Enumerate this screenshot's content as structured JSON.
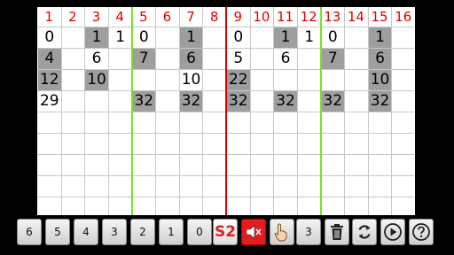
{
  "board": {
    "column_numbers": [
      "1",
      "2",
      "3",
      "4",
      "5",
      "6",
      "7",
      "8",
      "9",
      "10",
      "11",
      "12",
      "13",
      "14",
      "15",
      "16"
    ],
    "separator_colors": {
      "green": "#7be02a",
      "red": "#e00000"
    },
    "cells": [
      {
        "row": 0,
        "col": 0,
        "value": "0",
        "shaded": false
      },
      {
        "row": 0,
        "col": 2,
        "value": "1",
        "shaded": true
      },
      {
        "row": 0,
        "col": 3,
        "value": "1",
        "shaded": false
      },
      {
        "row": 0,
        "col": 4,
        "value": "0",
        "shaded": false
      },
      {
        "row": 0,
        "col": 6,
        "value": "1",
        "shaded": true
      },
      {
        "row": 0,
        "col": 8,
        "value": "0",
        "shaded": false
      },
      {
        "row": 0,
        "col": 10,
        "value": "1",
        "shaded": true
      },
      {
        "row": 0,
        "col": 11,
        "value": "1",
        "shaded": false
      },
      {
        "row": 0,
        "col": 12,
        "value": "0",
        "shaded": false
      },
      {
        "row": 0,
        "col": 14,
        "value": "1",
        "shaded": true
      },
      {
        "row": 1,
        "col": 0,
        "value": "4",
        "shaded": true
      },
      {
        "row": 1,
        "col": 2,
        "value": "6",
        "shaded": false
      },
      {
        "row": 1,
        "col": 4,
        "value": "7",
        "shaded": true
      },
      {
        "row": 1,
        "col": 6,
        "value": "6",
        "shaded": true
      },
      {
        "row": 1,
        "col": 8,
        "value": "5",
        "shaded": false
      },
      {
        "row": 1,
        "col": 10,
        "value": "6",
        "shaded": false
      },
      {
        "row": 1,
        "col": 12,
        "value": "7",
        "shaded": true
      },
      {
        "row": 1,
        "col": 14,
        "value": "6",
        "shaded": true
      },
      {
        "row": 2,
        "col": 0,
        "value": "12",
        "shaded": true
      },
      {
        "row": 2,
        "col": 2,
        "value": "10",
        "shaded": true
      },
      {
        "row": 2,
        "col": 6,
        "value": "10",
        "shaded": false
      },
      {
        "row": 2,
        "col": 8,
        "value": "22",
        "shaded": true
      },
      {
        "row": 2,
        "col": 14,
        "value": "10",
        "shaded": true
      },
      {
        "row": 3,
        "col": 0,
        "value": "29",
        "shaded": false
      },
      {
        "row": 3,
        "col": 4,
        "value": "32",
        "shaded": true
      },
      {
        "row": 3,
        "col": 6,
        "value": "32",
        "shaded": true
      },
      {
        "row": 3,
        "col": 8,
        "value": "32",
        "shaded": true
      },
      {
        "row": 3,
        "col": 10,
        "value": "32",
        "shaded": true
      },
      {
        "row": 3,
        "col": 12,
        "value": "32",
        "shaded": true
      },
      {
        "row": 3,
        "col": 14,
        "value": "32",
        "shaded": true
      }
    ]
  },
  "toolbar": {
    "number_buttons": [
      "6",
      "5",
      "4",
      "3",
      "2",
      "1",
      "0"
    ],
    "s2_label": "S2",
    "speaker_icon": "speaker-muted-icon",
    "hand_icon": "pointing-hand-icon",
    "count_label": "3",
    "trash_icon": "trash-icon",
    "refresh_icon": "refresh-icon",
    "play_icon": "play-icon",
    "help_icon": "help-icon",
    "accent_red": "#e41c1c"
  }
}
